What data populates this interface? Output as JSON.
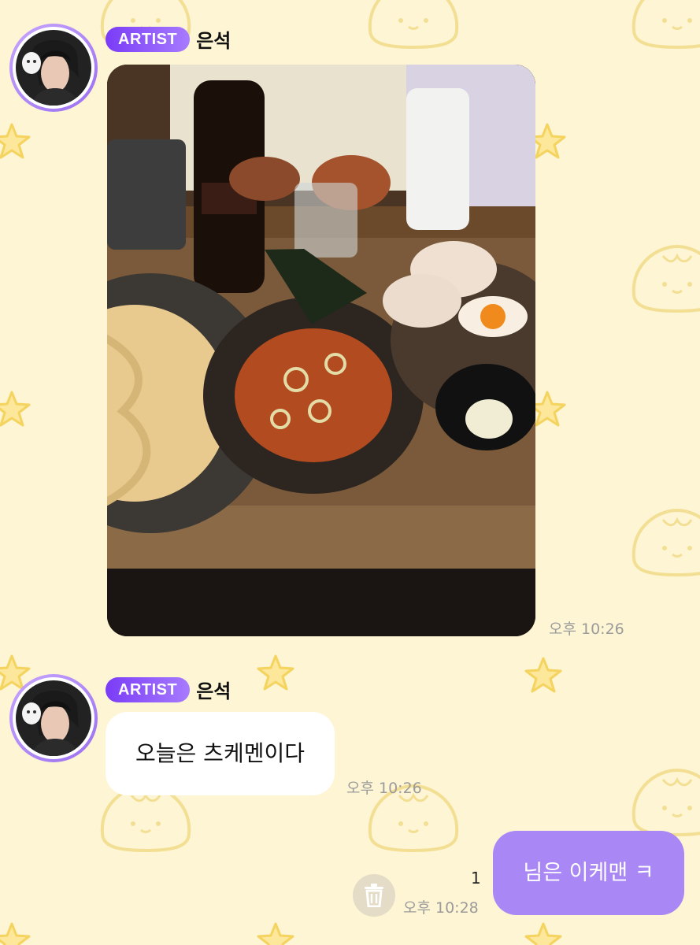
{
  "colors": {
    "background": "#fdf5d3",
    "badge_gradient_start": "#7a3cf7",
    "badge_gradient_end": "#a77bff",
    "my_bubble": "#a987f4",
    "their_bubble": "#ffffff",
    "timestamp": "#9b9b9b"
  },
  "messages": [
    {
      "sender_badge": "ARTIST",
      "sender_name": "은석",
      "type": "image",
      "image_description_icon": "food-photo",
      "time": "오후 10:26"
    },
    {
      "sender_badge": "ARTIST",
      "sender_name": "은석",
      "type": "text",
      "text": "오늘은 츠케멘이다",
      "time": "오후 10:26"
    },
    {
      "type": "text",
      "outgoing": true,
      "text": "님은 이케맨 ㅋ",
      "unread_count": "1",
      "time": "오후 10:28",
      "delete_icon": "trash-icon"
    }
  ]
}
